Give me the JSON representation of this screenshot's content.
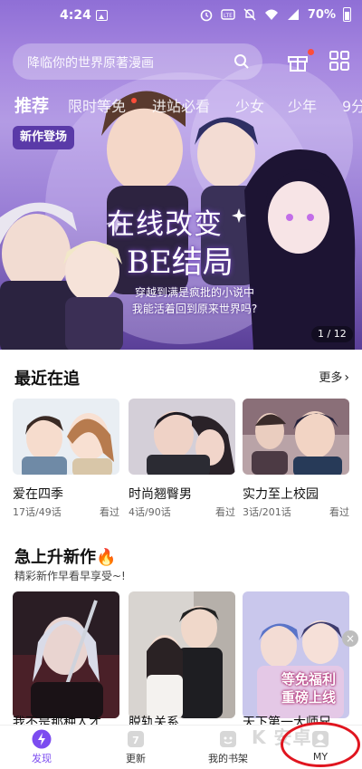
{
  "status_bar": {
    "time": "4:24",
    "battery": "70%",
    "icons": [
      "image-icon",
      "alarm-icon",
      "volte-icon",
      "mute-icon",
      "wifi-icon",
      "signal-icon",
      "battery-icon"
    ]
  },
  "header": {
    "search_placeholder": "降临你的世界原著漫画",
    "icons": [
      "search-icon",
      "gift-icon",
      "grid-menu-icon"
    ]
  },
  "tabs": [
    {
      "label": "推荐",
      "active": true
    },
    {
      "label": "限时等免",
      "badge": true
    },
    {
      "label": "进站必看"
    },
    {
      "label": "少女"
    },
    {
      "label": "少年"
    },
    {
      "label": "9分"
    }
  ],
  "banner": {
    "badge": "新作登场",
    "title_line1": "在线改变",
    "title_line2": "BE结局",
    "subtitle_line1": "穿越到满是疯批的小说中",
    "subtitle_line2": "我能活着回到原来世界吗?",
    "pager": "1 / 12"
  },
  "recent": {
    "title": "最近在追",
    "more": "更多",
    "items": [
      {
        "title": "爱在四季",
        "progress": "17话/49话",
        "seen": "看过"
      },
      {
        "title": "时尚翘臀男",
        "progress": "4话/90话",
        "seen": "看过"
      },
      {
        "title": "实力至上校园",
        "progress": "3话/201话",
        "seen": "看过"
      }
    ]
  },
  "rising": {
    "title": "急上升新作",
    "fire": "🔥",
    "subtitle": "精彩新作早看早享受~!",
    "items": [
      {
        "title": "我不是那种人才"
      },
      {
        "title": "脱轨关系"
      },
      {
        "title": "天下第一大师兄"
      }
    ],
    "promo_line1": "等免福利",
    "promo_line2": "重磅上线",
    "close": "×"
  },
  "bottom_nav": [
    {
      "label": "发现",
      "active": true
    },
    {
      "label": "更新",
      "icon_text": "7"
    },
    {
      "label": "我的书架"
    },
    {
      "label": "MY"
    }
  ],
  "watermark": "K  安卓"
}
